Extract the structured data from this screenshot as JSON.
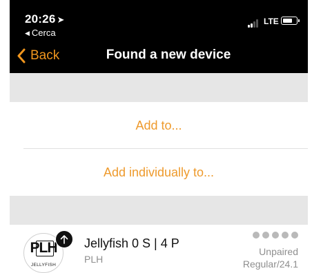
{
  "status_bar": {
    "time": "20:26",
    "location_arrow_icon": "location-arrow",
    "back_app_label": "Cerca",
    "network": "LTE",
    "signal_bars_active": 2,
    "signal_bars_total": 4,
    "battery_level_fraction": 0.55
  },
  "nav": {
    "back_label": "Back",
    "title": "Found a new device"
  },
  "actions": {
    "add_to": "Add to...",
    "add_individually_to": "Add individually to..."
  },
  "device": {
    "logo_text": "PLH",
    "logo_subtext": "JELLYFISH",
    "name": "Jellyfish 0 S | 4 P",
    "brand": "PLH",
    "status": "Unpaired",
    "firmware": "Regular/24.1",
    "signal_dots": 5
  },
  "colors": {
    "accent": "#F0961E",
    "nav_background": "#000000",
    "section_gray": "#E6E6E6",
    "secondary_text": "#8E8E8E"
  }
}
